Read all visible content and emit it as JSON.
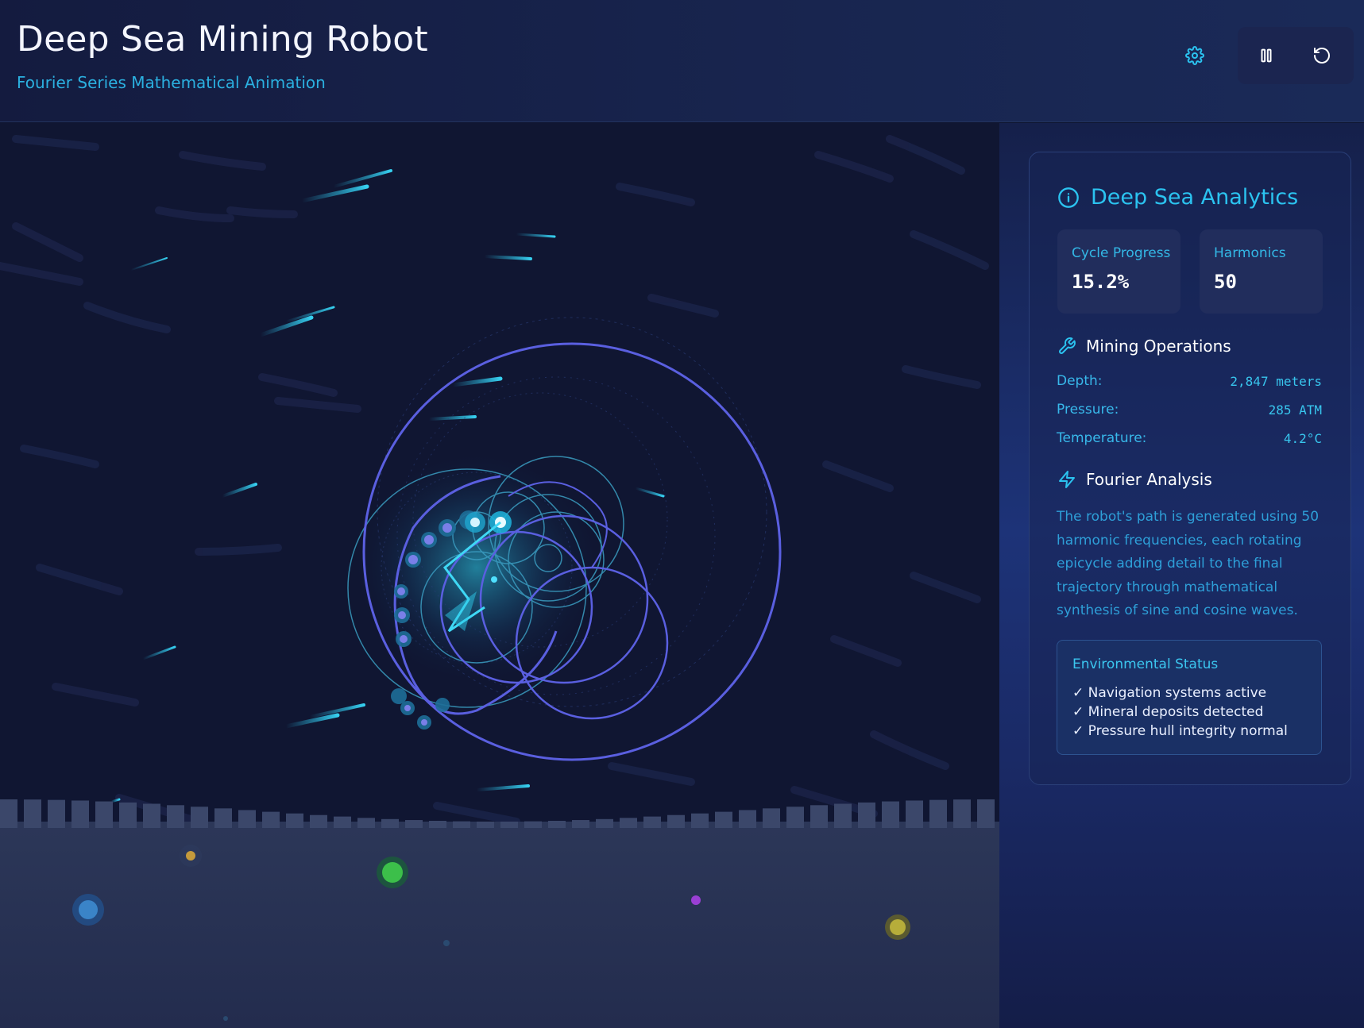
{
  "header": {
    "title": "Deep Sea Mining Robot",
    "subtitle": "Fourier Series Mathematical Animation",
    "buttons": {
      "settings": "gear-icon",
      "pause": "pause-icon",
      "reset": "rotate-ccw-icon"
    }
  },
  "analytics": {
    "title": "Deep Sea Analytics",
    "stats": [
      {
        "label": "Cycle Progress",
        "value": "15.2%"
      },
      {
        "label": "Harmonics",
        "value": "50"
      }
    ],
    "mining": {
      "title": "Mining Operations",
      "rows": [
        {
          "label": "Depth:",
          "value": "2,847 meters"
        },
        {
          "label": "Pressure:",
          "value": "285 ATM"
        },
        {
          "label": "Temperature:",
          "value": "4.2°C"
        }
      ]
    },
    "fourier": {
      "title": "Fourier Analysis",
      "description": "The robot's path is generated using 50 harmonic frequencies, each rotating epicycle adding detail to the final trajectory through mathematical synthesis of sine and cosine waves."
    },
    "environment": {
      "title": "Environmental Status",
      "items": [
        "✓ Navigation systems active",
        "✓ Mineral deposits detected",
        "✓ Pressure hull integrity normal"
      ]
    }
  },
  "colors": {
    "accent": "#2bc3f0",
    "epicycle": "#5a5fe0",
    "scene_bg": "#101632",
    "seafloor": "#2a3556"
  }
}
